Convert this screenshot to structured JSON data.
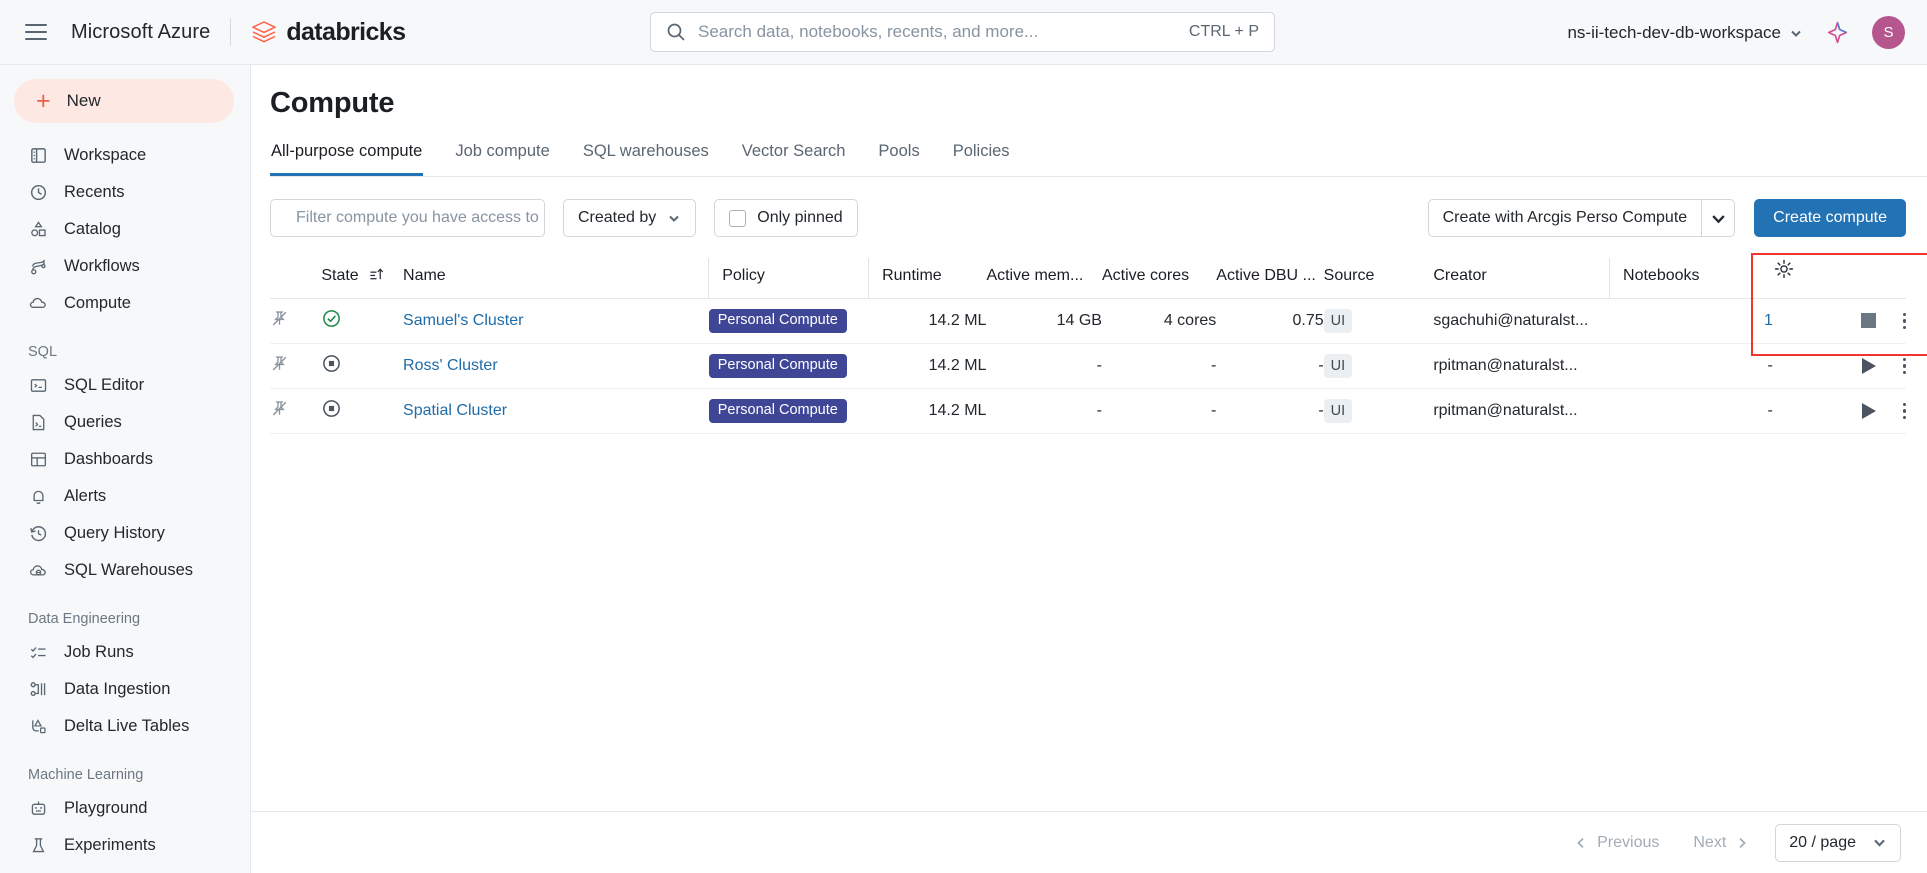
{
  "topbar": {
    "hamburger_icon": "hamburger-menu-icon",
    "azure_brand": "Microsoft Azure",
    "databricks_brand": "databricks",
    "databricks_logo_icon": "databricks-logo-icon",
    "search": {
      "icon": "search-icon",
      "placeholder": "Search data, notebooks, recents, and more...",
      "shortcut": "CTRL + P"
    },
    "workspace": {
      "name": "ns-ii-tech-dev-db-workspace",
      "chevron_icon": "chevron-down-icon"
    },
    "assistant_icon": "sparkle-icon",
    "avatar_initial": "S",
    "avatar_color": "#b5568f"
  },
  "sidebar": {
    "new_button": {
      "label": "New",
      "icon": "plus-icon",
      "bg": "#fde8e4",
      "accent": "#e8614b"
    },
    "items": [
      {
        "label": "Workspace",
        "icon": "workspace-icon"
      },
      {
        "label": "Recents",
        "icon": "clock-icon"
      },
      {
        "label": "Catalog",
        "icon": "catalog-shapes-icon"
      },
      {
        "label": "Workflows",
        "icon": "workflows-nodes-icon"
      },
      {
        "label": "Compute",
        "icon": "cloud-icon"
      }
    ],
    "groups": [
      {
        "label": "SQL",
        "items": [
          {
            "label": "SQL Editor",
            "icon": "sql-editor-icon"
          },
          {
            "label": "Queries",
            "icon": "query-document-icon"
          },
          {
            "label": "Dashboards",
            "icon": "dashboard-grid-icon"
          },
          {
            "label": "Alerts",
            "icon": "bell-icon"
          },
          {
            "label": "Query History",
            "icon": "history-clock-icon"
          },
          {
            "label": "SQL Warehouses",
            "icon": "warehouse-cloud-icon"
          }
        ]
      },
      {
        "label": "Data Engineering",
        "items": [
          {
            "label": "Job Runs",
            "icon": "job-runs-checklist-icon"
          },
          {
            "label": "Data Ingestion",
            "icon": "data-ingestion-icon"
          },
          {
            "label": "Delta Live Tables",
            "icon": "delta-live-tables-icon"
          }
        ]
      },
      {
        "label": "Machine Learning",
        "items": [
          {
            "label": "Playground",
            "icon": "robot-icon"
          },
          {
            "label": "Experiments",
            "icon": "experiments-flask-icon"
          }
        ]
      }
    ]
  },
  "main": {
    "page_title": "Compute",
    "tabs": [
      {
        "label": "All-purpose compute",
        "active": true
      },
      {
        "label": "Job compute",
        "active": false
      },
      {
        "label": "SQL warehouses",
        "active": false
      },
      {
        "label": "Vector Search",
        "active": false
      },
      {
        "label": "Pools",
        "active": false
      },
      {
        "label": "Policies",
        "active": false
      }
    ],
    "active_tab_color": "#2272b4",
    "toolbar": {
      "filter_placeholder": "Filter compute you have access to",
      "filter_value": "",
      "filter_icon": "search-icon",
      "created_by_label": "Created by",
      "created_by_chevron_icon": "chevron-down-icon",
      "only_pinned_label": "Only pinned",
      "only_pinned_checked": false,
      "only_pinned_checkbox_icon": "checkbox-unchecked-icon",
      "split_dropdown_label": "Create with Arcgis Perso Compute",
      "split_dropdown_chevron_icon": "chevron-down-icon",
      "primary_button_label": "Create compute",
      "primary_button_color": "#2272b4"
    },
    "highlight_color": "#f2342c",
    "table": {
      "columns": [
        {
          "key": "pin",
          "label": "",
          "align": "left"
        },
        {
          "key": "state",
          "label": "State",
          "align": "left",
          "sorted": true,
          "sort_icon": "sort-ascending-icon"
        },
        {
          "key": "name",
          "label": "Name",
          "align": "left"
        },
        {
          "key": "policy",
          "label": "Policy",
          "align": "left",
          "divider": true
        },
        {
          "key": "runtime",
          "label": "Runtime",
          "align": "right",
          "divider": true
        },
        {
          "key": "memory",
          "label": "Active mem...",
          "align": "right"
        },
        {
          "key": "cores",
          "label": "Active cores",
          "align": "right"
        },
        {
          "key": "dbu",
          "label": "Active DBU ...",
          "align": "right"
        },
        {
          "key": "source",
          "label": "Source",
          "align": "left"
        },
        {
          "key": "creator",
          "label": "Creator",
          "align": "left"
        },
        {
          "key": "notebooks",
          "label": "Notebooks",
          "align": "right",
          "divider": true
        },
        {
          "key": "actions",
          "label": "",
          "align": "right"
        }
      ],
      "settings_gear_icon": "gear-icon",
      "rows": [
        {
          "pin_icon": "pin-off-icon",
          "state": "running",
          "state_icon": "check-circle-icon",
          "name": "Samuel's Cluster",
          "policy": "Personal Compute",
          "policy_color": "#3f4696",
          "runtime": "14.2 ML",
          "memory": "14 GB",
          "cores": "4 cores",
          "dbu": "0.75",
          "source": "UI",
          "creator": "sgachuhi@naturalst...",
          "notebooks": "1",
          "action_icon": "stop-square-icon",
          "kebab_icon": "kebab-menu-icon"
        },
        {
          "pin_icon": "pin-off-icon",
          "state": "terminated",
          "state_icon": "stop-circle-icon",
          "name": "Ross' Cluster",
          "policy": "Personal Compute",
          "policy_color": "#3f4696",
          "runtime": "14.2 ML",
          "memory": "-",
          "cores": "-",
          "dbu": "-",
          "source": "UI",
          "creator": "rpitman@naturalst...",
          "notebooks": "-",
          "action_icon": "play-triangle-icon",
          "kebab_icon": "kebab-menu-icon"
        },
        {
          "pin_icon": "pin-off-icon",
          "state": "terminated",
          "state_icon": "stop-circle-icon",
          "name": "Spatial Cluster",
          "policy": "Personal Compute",
          "policy_color": "#3f4696",
          "runtime": "14.2 ML",
          "memory": "-",
          "cores": "-",
          "dbu": "-",
          "source": "UI",
          "creator": "rpitman@naturalst...",
          "notebooks": "-",
          "action_icon": "play-triangle-icon",
          "kebab_icon": "kebab-menu-icon"
        }
      ]
    },
    "pagination": {
      "previous_label": "Previous",
      "previous_icon": "chevron-left-icon",
      "next_label": "Next",
      "next_icon": "chevron-right-icon",
      "page_size_value": "20 / page",
      "page_size_chevron_icon": "chevron-down-icon"
    }
  }
}
